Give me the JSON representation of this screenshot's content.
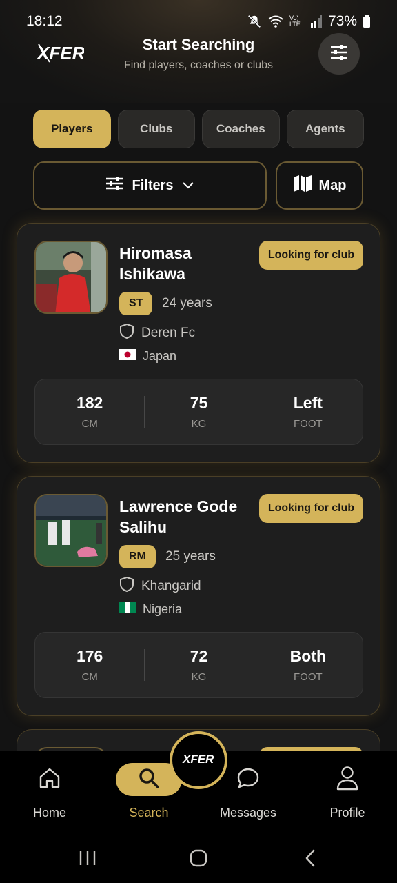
{
  "status_bar": {
    "time": "18:12",
    "network": "Vo) LTE",
    "battery": "73%"
  },
  "header": {
    "logo_text": "XFER",
    "title": "Start Searching",
    "subtitle": "Find players, coaches or clubs"
  },
  "tabs": [
    {
      "label": "Players",
      "active": true
    },
    {
      "label": "Clubs",
      "active": false
    },
    {
      "label": "Coaches",
      "active": false
    },
    {
      "label": "Agents",
      "active": false
    }
  ],
  "filters": {
    "filters_label": "Filters",
    "map_label": "Map"
  },
  "players": [
    {
      "name": "Hiromasa Ishikawa",
      "status": "Looking for club",
      "position": "ST",
      "age": "24 years",
      "club": "Deren Fc",
      "country": "Japan",
      "flag": "🇯🇵",
      "stats": [
        {
          "value": "182",
          "unit": "CM"
        },
        {
          "value": "75",
          "unit": "KG"
        },
        {
          "value": "Left",
          "unit": "FOOT"
        }
      ]
    },
    {
      "name": "Lawrence Gode Salihu",
      "status": "Looking for club",
      "position": "RM",
      "age": "25 years",
      "club": "Khangarid",
      "country": "Nigeria",
      "flag": "🇳🇬",
      "stats": [
        {
          "value": "176",
          "unit": "CM"
        },
        {
          "value": "72",
          "unit": "KG"
        },
        {
          "value": "Both",
          "unit": "FOOT"
        }
      ]
    }
  ],
  "bottom_nav": [
    {
      "label": "Home",
      "icon": "home-icon",
      "active": false
    },
    {
      "label": "Search",
      "icon": "search-icon",
      "active": true
    },
    {
      "label": "Messages",
      "icon": "chat-icon",
      "active": false
    },
    {
      "label": "Profile",
      "icon": "user-icon",
      "active": false
    }
  ],
  "colors": {
    "accent": "#d4b45a",
    "background": "#131313",
    "card": "#1e1e1e"
  }
}
